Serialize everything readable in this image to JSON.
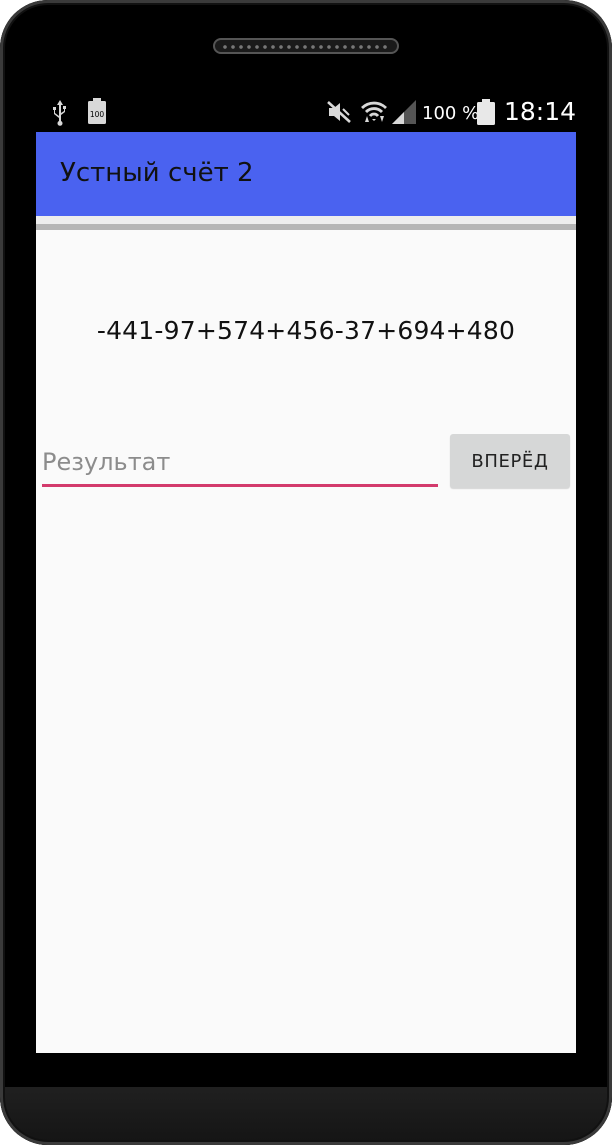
{
  "status_bar": {
    "battery_icon_text": "100",
    "battery_percent": "100 %",
    "time": "18:14",
    "icons": [
      "usb-icon",
      "battery-saver-icon",
      "mute-icon",
      "wifi-icon",
      "signal-icon",
      "battery-icon"
    ]
  },
  "app_bar": {
    "title": "Устный счёт 2",
    "color": "#4a62f0"
  },
  "main": {
    "expression": "-441-97+574+456-37+694+480",
    "result_input": {
      "placeholder": "Результат",
      "value": ""
    },
    "forward_button_label": "ВПЕРЁД"
  },
  "colors": {
    "accent": "#d33a6c",
    "screen_background": "#fafafa",
    "button_background": "#d6d7d7"
  }
}
